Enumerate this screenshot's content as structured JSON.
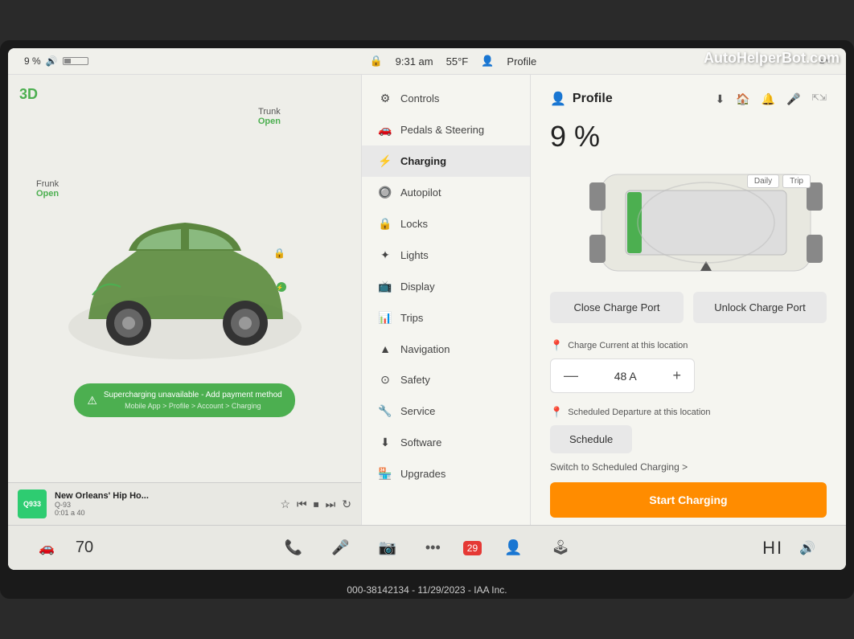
{
  "watermark": "AutoHelperBot.com",
  "statusBar": {
    "battery": "9 %",
    "bluetoothIcon": "🔊",
    "batteryBars": "▌▌▌",
    "lockIcon": "🔒",
    "time": "9:31 am",
    "temp": "55°F",
    "profileIcon": "👤",
    "profileLabel": "Profile"
  },
  "leftPanel": {
    "threedLabel": "3D",
    "trunkLabel": "Trunk",
    "trunkStatus": "Open",
    "frunkLabel": "Frunk",
    "frunkStatus": "Open",
    "alertText": "Supercharging unavailable - Add payment method",
    "alertSubText": "Mobile App > Profile > Account > Charging"
  },
  "musicPlayer": {
    "albumLabel": "Q933",
    "songTitle": "New Orleans' Hip Ho...",
    "songSub": "Q-93",
    "timeInfo": "0:01 a 40"
  },
  "navMenu": {
    "items": [
      {
        "id": "controls",
        "icon": "⚙",
        "label": "Controls",
        "active": false
      },
      {
        "id": "pedals",
        "icon": "🚗",
        "label": "Pedals & Steering",
        "active": false
      },
      {
        "id": "charging",
        "icon": "⚡",
        "label": "Charging",
        "active": true
      },
      {
        "id": "autopilot",
        "icon": "🔘",
        "label": "Autopilot",
        "active": false
      },
      {
        "id": "locks",
        "icon": "🔒",
        "label": "Locks",
        "active": false
      },
      {
        "id": "lights",
        "icon": "✦",
        "label": "Lights",
        "active": false
      },
      {
        "id": "display",
        "icon": "📺",
        "label": "Display",
        "active": false
      },
      {
        "id": "trips",
        "icon": "📊",
        "label": "Trips",
        "active": false
      },
      {
        "id": "navigation",
        "icon": "▲",
        "label": "Navigation",
        "active": false
      },
      {
        "id": "safety",
        "icon": "⊙",
        "label": "Safety",
        "active": false
      },
      {
        "id": "service",
        "icon": "🔧",
        "label": "Service",
        "active": false
      },
      {
        "id": "software",
        "icon": "⬇",
        "label": "Software",
        "active": false
      },
      {
        "id": "upgrades",
        "icon": "🏪",
        "label": "Upgrades",
        "active": false
      }
    ]
  },
  "contentPanel": {
    "profileLabel": "Profile",
    "batteryPercent": "9 %",
    "dailyLabel": "Daily",
    "tripLabel": "Trip",
    "closeChargePort": "Close Charge Port",
    "unlockChargePort": "Unlock Charge Port",
    "chargeCurrentLabel": "Charge Current at this location",
    "pinIcon": "📍",
    "currentMinus": "—",
    "currentValue": "48 A",
    "currentPlus": "+",
    "scheduledDepartureLabel": "Scheduled Departure at this location",
    "scheduleBtn": "Schedule",
    "switchLink": "Switch to Scheduled Charging >",
    "startChargeBtn": "Start Charging"
  },
  "taskbar": {
    "carIcon": "🚗",
    "speed": "70",
    "phoneIcon": "📞",
    "micIcon": "🎤",
    "cameraIcon": "📷",
    "moreIcon": "•••",
    "calendarIcon": "29",
    "peopleIcon": "👤",
    "joystickIcon": "🕹",
    "hiLabel": "HI",
    "volumeIcon": "🔊"
  },
  "caption": "000-38142134 - 11/29/2023 - IAA Inc."
}
